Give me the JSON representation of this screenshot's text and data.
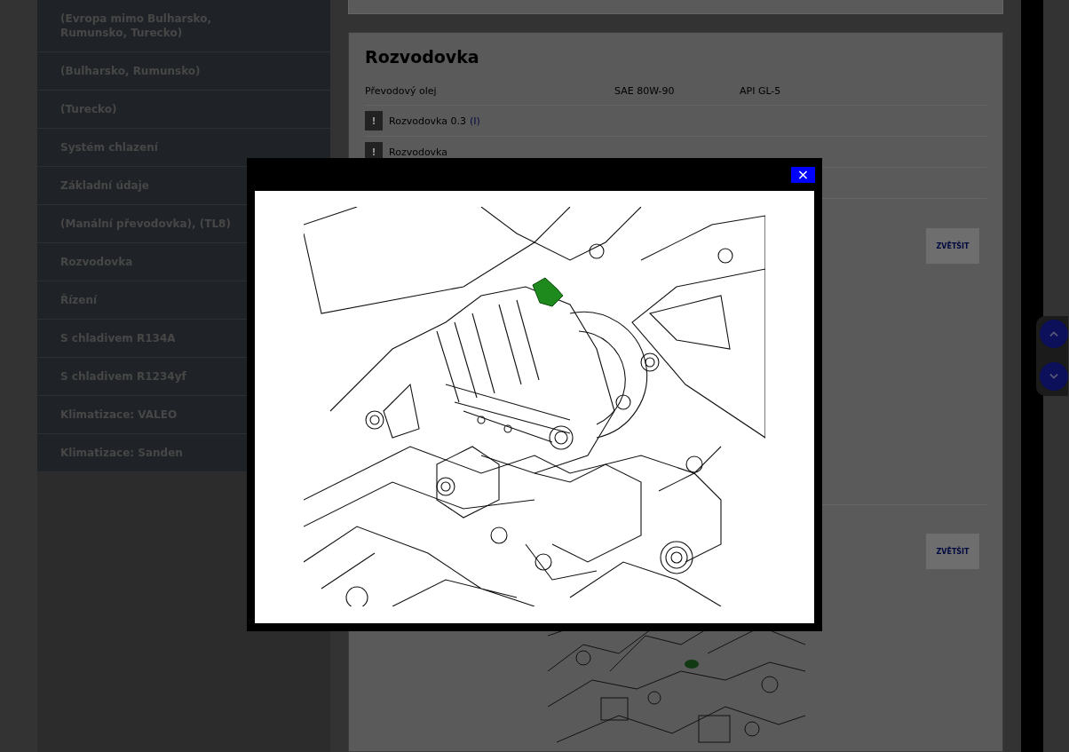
{
  "sidebar": {
    "items": [
      {
        "label": "(Evropa mimo Bulharsko, Rumunsko, Turecko)"
      },
      {
        "label": "(Bulharsko, Rumunsko)"
      },
      {
        "label": "(Turecko)"
      },
      {
        "label": "Systém chlazení"
      },
      {
        "label": "Základní údaje"
      },
      {
        "label": "(Manální převodovka), (TL8)"
      },
      {
        "label": "Rozvodovka"
      },
      {
        "label": "Řízení"
      },
      {
        "label": "S chladivem R134A"
      },
      {
        "label": "S chladivem R1234yf"
      },
      {
        "label": "Klimatizace: VALEO"
      },
      {
        "label": "Klimatizace: Sanden"
      }
    ]
  },
  "section": {
    "title": "Rozvodovka",
    "spec": {
      "label": "Převodový olej",
      "grade": "SAE 80W-90",
      "standard": "API GL-5"
    },
    "notes": [
      {
        "icon": "!",
        "text": "Rozvodovka 0.3",
        "link": "(I)"
      },
      {
        "icon": "!",
        "text": "Rozvodovka"
      }
    ],
    "zoom_buttons": [
      "ZVĚTŠIT",
      "ZVĚTŠIT"
    ]
  },
  "modal": {
    "close": "×"
  }
}
